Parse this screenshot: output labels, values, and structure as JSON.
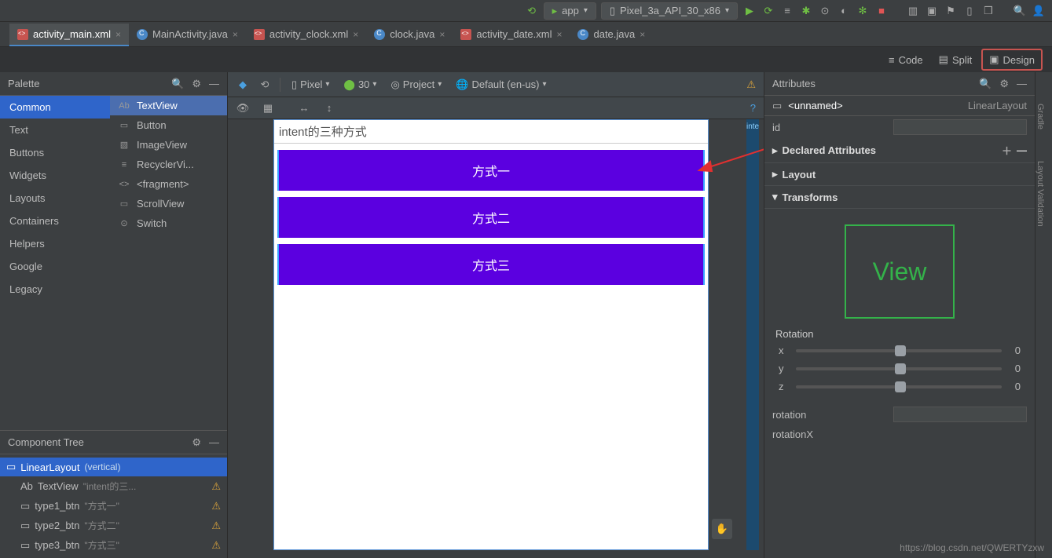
{
  "toolbar": {
    "run_config": "app",
    "device": "Pixel_3a_API_30_x86"
  },
  "tabs": [
    {
      "label": "activity_main.xml",
      "type": "xml",
      "active": true
    },
    {
      "label": "MainActivity.java",
      "type": "java"
    },
    {
      "label": "activity_clock.xml",
      "type": "xml"
    },
    {
      "label": "clock.java",
      "type": "java"
    },
    {
      "label": "activity_date.xml",
      "type": "xml"
    },
    {
      "label": "date.java",
      "type": "java"
    }
  ],
  "view_modes": {
    "code": "Code",
    "split": "Split",
    "design": "Design"
  },
  "palette": {
    "title": "Palette",
    "categories": [
      "Common",
      "Text",
      "Buttons",
      "Widgets",
      "Layouts",
      "Containers",
      "Helpers",
      "Google",
      "Legacy"
    ],
    "items": [
      {
        "label": "TextView",
        "prefix": "Ab"
      },
      {
        "label": "Button",
        "prefix": "▭"
      },
      {
        "label": "ImageView",
        "prefix": "▧"
      },
      {
        "label": "RecyclerVi...",
        "prefix": "≡"
      },
      {
        "label": "<fragment>",
        "prefix": "<>"
      },
      {
        "label": "ScrollView",
        "prefix": "▭"
      },
      {
        "label": "Switch",
        "prefix": "⊙"
      }
    ]
  },
  "component_tree": {
    "title": "Component Tree",
    "root": {
      "label": "LinearLayout",
      "mod": "(vertical)"
    },
    "children": [
      {
        "icon": "Ab",
        "label": "TextView",
        "sub": "\"intent的三...",
        "warn": true
      },
      {
        "icon": "▭",
        "label": "type1_btn",
        "sub": "\"方式一\"",
        "warn": true
      },
      {
        "icon": "▭",
        "label": "type2_btn",
        "sub": "\"方式二\"",
        "warn": true
      },
      {
        "icon": "▭",
        "label": "type3_btn",
        "sub": "\"方式三\"",
        "warn": true
      }
    ]
  },
  "design_toolbar": {
    "device": "Pixel",
    "api": "30",
    "theme": "Project",
    "locale": "Default (en-us)"
  },
  "mock": {
    "title": "intent的三种方式",
    "btns": [
      "方式一",
      "方式二",
      "方式三"
    ],
    "hint": "inte"
  },
  "attributes": {
    "title": "Attributes",
    "selected": "<unnamed>",
    "type": "LinearLayout",
    "id_label": "id",
    "sections": {
      "declared": "Declared Attributes",
      "layout": "Layout",
      "transforms": "Transforms"
    },
    "view_label": "View",
    "rotation_label": "Rotation",
    "axes": [
      {
        "a": "x",
        "v": "0"
      },
      {
        "a": "y",
        "v": "0"
      },
      {
        "a": "z",
        "v": "0"
      }
    ],
    "rotation_field": "rotation",
    "rotationX_field": "rotationX"
  },
  "rail": {
    "gradle": "Gradle",
    "layoutval": "Layout Validation"
  },
  "watermark": "https://blog.csdn.net/QWERTYzxw"
}
